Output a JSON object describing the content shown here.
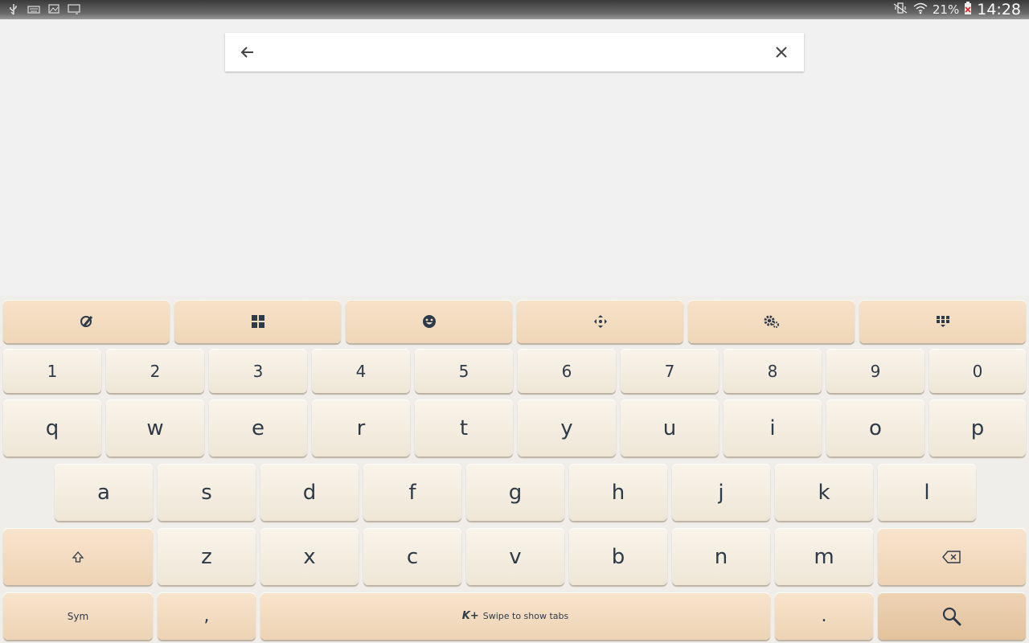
{
  "status_bar": {
    "battery_percent": "21%",
    "time": "14:28",
    "left_icons": [
      "usb-icon",
      "keyboard-icon",
      "image-icon",
      "cast-icon"
    ],
    "right_icons": [
      "mute-vibrate-icon",
      "wifi-icon",
      "battery-icon"
    ]
  },
  "search": {
    "value": "",
    "placeholder": "",
    "back_icon": "arrow-left-icon",
    "clear_icon": "close-icon"
  },
  "keyboard": {
    "toolbar": [
      "brush-icon",
      "numpad-icon",
      "emoji-icon",
      "move-icon",
      "gear-icon",
      "grid-icon"
    ],
    "number_row": [
      "1",
      "2",
      "3",
      "4",
      "5",
      "6",
      "7",
      "8",
      "9",
      "0"
    ],
    "row_q": [
      "q",
      "w",
      "e",
      "r",
      "t",
      "y",
      "u",
      "i",
      "o",
      "p"
    ],
    "row_a": [
      "a",
      "s",
      "d",
      "f",
      "g",
      "h",
      "j",
      "k",
      "l"
    ],
    "row_z": [
      "z",
      "x",
      "c",
      "v",
      "b",
      "n",
      "m"
    ],
    "sym_label": "Sym",
    "comma": ",",
    "space_logo": "K+",
    "space_label": "Swipe to show tabs",
    "period": ".",
    "colors": {
      "key_face": "#f9f4ea",
      "function_key": "#f0d7b8",
      "text": "#2d3a4a"
    }
  }
}
